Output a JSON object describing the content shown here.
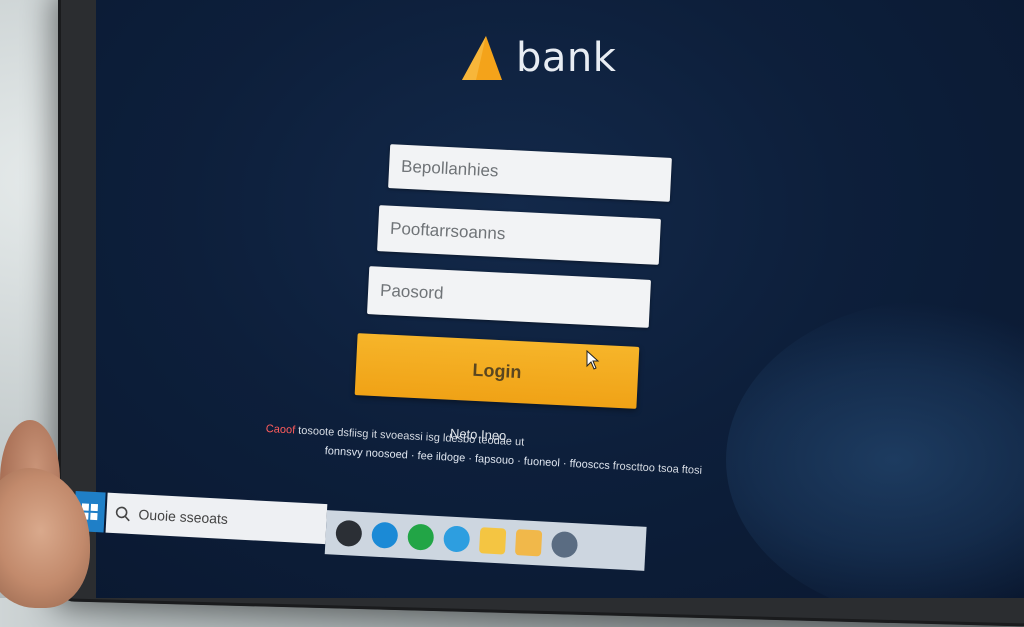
{
  "brand": {
    "name": "bank"
  },
  "login_form": {
    "field_1_placeholder": "Bepollanhies",
    "field_2_placeholder": "Pooftarrsoanns",
    "password_placeholder": "Paosord",
    "login_label": "Login",
    "new_here_text": "Neto Ineo"
  },
  "legal_text": {
    "line_1_red": "Caoof",
    "line_1": "tosoote dsfiisg it svoeassi isg ldesbo teodae ut",
    "line_2": "fonnsvy noosoed · fee ildoge · fapsouo · fuoneol · ffoosccs",
    "line_2_tail": "froscttoo tsoa ftosi"
  },
  "taskbar": {
    "search_placeholder": "Ouoie sseoats",
    "tray_icons": [
      "settings-icon",
      "edge-icon",
      "store-icon",
      "browser-icon",
      "folder-icon",
      "files-icon",
      "chrome-icon"
    ]
  },
  "colors": {
    "screen_bg": "#0d1f3b",
    "accent": "#f0a216",
    "field_bg": "#f2f3f5",
    "taskbar_start": "#1f7fc7"
  }
}
